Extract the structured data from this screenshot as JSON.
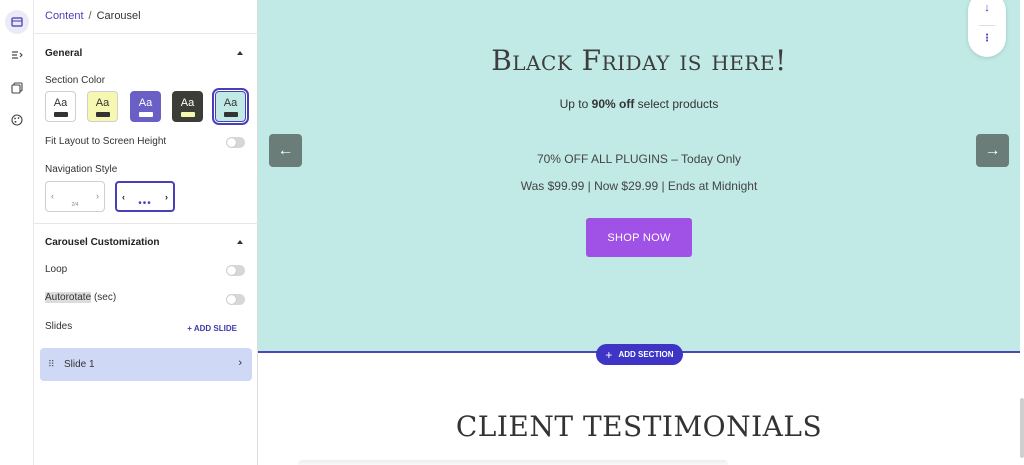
{
  "breadcrumb": {
    "parent": "Content",
    "separator": "/",
    "current": "Carousel"
  },
  "general": {
    "title": "General",
    "section_color_label": "Section Color",
    "swatches": [
      {
        "label": "Aa",
        "bg": "#ffffff",
        "bar": "#333333",
        "text": "#333333"
      },
      {
        "label": "Aa",
        "bg": "#f6f7b1",
        "bar": "#333333",
        "text": "#333333"
      },
      {
        "label": "Aa",
        "bg": "#6a5fc4",
        "bar": "#ffffff",
        "text": "#ffffff"
      },
      {
        "label": "Aa",
        "bg": "#3d3d38",
        "bar": "#f6f7b1",
        "text": "#ffffff"
      },
      {
        "label": "Aa",
        "bg": "#c1eae6",
        "bar": "#333333",
        "text": "#333333"
      }
    ],
    "fit_layout_label": "Fit Layout to Screen Height",
    "nav_style_label": "Navigation Style",
    "nav_count_text": "2/4",
    "nav_dots_text": "•••"
  },
  "carousel_customization": {
    "title": "Carousel Customization",
    "loop_label": "Loop",
    "autorotate_label": "Autorotate",
    "autorotate_suffix": "(sec)",
    "slides_label": "Slides",
    "add_slide_label": "+ ADD SLIDE",
    "slides": [
      {
        "name": "Slide 1"
      }
    ]
  },
  "hero": {
    "title": "Black Friday is here!",
    "sub_prefix": "Up to ",
    "sub_bold": "90% off",
    "sub_suffix": " select products",
    "line1": "70% OFF ALL PLUGINS – Today Only",
    "line2": "Was $99.99 | Now $29.99 | Ends at Midnight",
    "button": "SHOP NOW",
    "prev_arrow": "←",
    "next_arrow": "→",
    "bg_color": "#c1eae6"
  },
  "add_section_label": "ADD SECTION",
  "testimonials_title": "CLIENT TESTIMONIALS",
  "colors": {
    "accent": "#4b3fb8",
    "button": "#a152e6"
  }
}
